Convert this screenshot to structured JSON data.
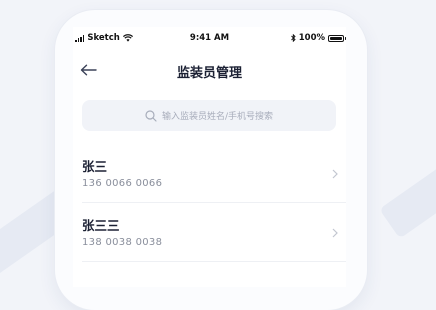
{
  "status_bar": {
    "carrier": "Sketch",
    "time": "9:41 AM",
    "battery": "100%"
  },
  "header": {
    "title": "监装员管理"
  },
  "search": {
    "placeholder": "输入监装员姓名/手机号搜索"
  },
  "inspectors": [
    {
      "name": "张三",
      "phone": "136 0066 0066"
    },
    {
      "name": "张三三",
      "phone": "138 0038 0038"
    }
  ],
  "colors": {
    "title": "#1b2033",
    "muted": "#8a8f9c",
    "search_bg": "#f1f3f8"
  }
}
